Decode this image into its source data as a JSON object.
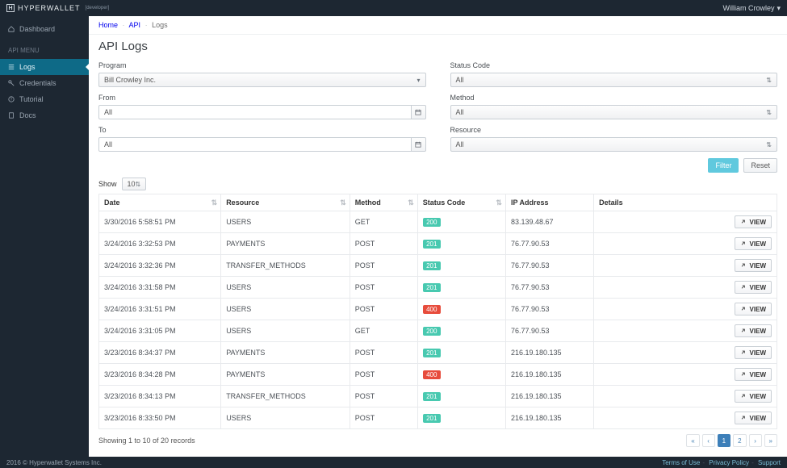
{
  "brand": {
    "name": "HYPERWALLET",
    "sub": "[developer]"
  },
  "user": {
    "name": "William Crowley"
  },
  "sidebar": {
    "dashboard": "Dashboard",
    "section_label": "API MENU",
    "items": [
      {
        "label": "Logs",
        "active": true
      },
      {
        "label": "Credentials"
      },
      {
        "label": "Tutorial"
      },
      {
        "label": "Docs"
      }
    ]
  },
  "breadcrumbs": [
    "Home",
    "API",
    "Logs"
  ],
  "page_title": "API Logs",
  "filters": {
    "program_label": "Program",
    "program_value": "Bill Crowley Inc.",
    "from_label": "From",
    "from_value": "All",
    "to_label": "To",
    "to_value": "All",
    "statuscode_label": "Status Code",
    "statuscode_value": "All",
    "method_label": "Method",
    "method_value": "All",
    "resource_label": "Resource",
    "resource_value": "All",
    "filter_btn": "Filter",
    "reset_btn": "Reset"
  },
  "show": {
    "label": "Show",
    "value": "10"
  },
  "columns": {
    "date": "Date",
    "resource": "Resource",
    "method": "Method",
    "status": "Status Code",
    "ip": "IP Address",
    "details": "Details"
  },
  "view_label": "VIEW",
  "rows": [
    {
      "date": "3/30/2016 5:58:51 PM",
      "resource": "USERS",
      "method": "GET",
      "status": "200",
      "ip": "83.139.48.67"
    },
    {
      "date": "3/24/2016 3:32:53 PM",
      "resource": "PAYMENTS",
      "method": "POST",
      "status": "201",
      "ip": "76.77.90.53"
    },
    {
      "date": "3/24/2016 3:32:36 PM",
      "resource": "TRANSFER_METHODS",
      "method": "POST",
      "status": "201",
      "ip": "76.77.90.53"
    },
    {
      "date": "3/24/2016 3:31:58 PM",
      "resource": "USERS",
      "method": "POST",
      "status": "201",
      "ip": "76.77.90.53"
    },
    {
      "date": "3/24/2016 3:31:51 PM",
      "resource": "USERS",
      "method": "POST",
      "status": "400",
      "ip": "76.77.90.53"
    },
    {
      "date": "3/24/2016 3:31:05 PM",
      "resource": "USERS",
      "method": "GET",
      "status": "200",
      "ip": "76.77.90.53"
    },
    {
      "date": "3/23/2016 8:34:37 PM",
      "resource": "PAYMENTS",
      "method": "POST",
      "status": "201",
      "ip": "216.19.180.135"
    },
    {
      "date": "3/23/2016 8:34:28 PM",
      "resource": "PAYMENTS",
      "method": "POST",
      "status": "400",
      "ip": "216.19.180.135"
    },
    {
      "date": "3/23/2016 8:34:13 PM",
      "resource": "TRANSFER_METHODS",
      "method": "POST",
      "status": "201",
      "ip": "216.19.180.135"
    },
    {
      "date": "3/23/2016 8:33:50 PM",
      "resource": "USERS",
      "method": "POST",
      "status": "201",
      "ip": "216.19.180.135"
    }
  ],
  "records_summary": "Showing 1 to 10 of 20 records",
  "pager": {
    "pages": [
      "1",
      "2"
    ],
    "active": "1"
  },
  "footer": {
    "copyright": "2016 © Hyperwallet Systems Inc.",
    "links": [
      "Terms of Use",
      "Privacy Policy",
      "Support"
    ]
  }
}
